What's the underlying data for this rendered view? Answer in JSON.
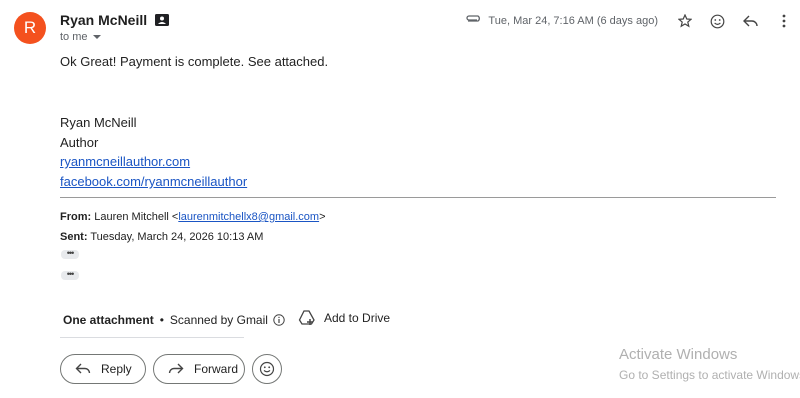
{
  "sender": {
    "avatar_letter": "R",
    "avatar_color": "#f4511e",
    "name": "Ryan McNeill",
    "contact_icon": "contact-card-icon",
    "recipient": "to me"
  },
  "meta": {
    "date": "Tue, Mar 24, 7:16 AM (6 days ago)",
    "icons": [
      "attachment-clip-icon",
      "star-icon",
      "emoji-icon",
      "reply-icon"
    ]
  },
  "message": {
    "body": "Ok Great! Payment is complete. See attached."
  },
  "signature": {
    "name": "Ryan McNeill",
    "role": "Author",
    "website": "ryanmcneillauthor.com",
    "facebook": "facebook.com/ryanmcneillauthor"
  },
  "quoted": {
    "from_label": "From:",
    "from_name": "Lauren Mitchell <",
    "from_email": "laurenmitchellx8@gmail.com",
    "from_close": ">",
    "sent_label": "Sent:",
    "sent_value": "Tuesday, March 24, 2026 10:13 AM",
    "expand_label": "•••"
  },
  "attachments": {
    "title": "One attachment",
    "dot": "•",
    "scan_status": "Scanned by Gmail",
    "add_to_drive": "Add to Drive"
  },
  "actions": {
    "reply": "Reply",
    "forward": "Forward"
  },
  "watermark": {
    "title": "Activate Windows",
    "subtitle": "Go to Settings to activate Windows."
  },
  "colors": {
    "link": "#1a55c4",
    "text": "#202124",
    "muted": "#5f6368"
  }
}
